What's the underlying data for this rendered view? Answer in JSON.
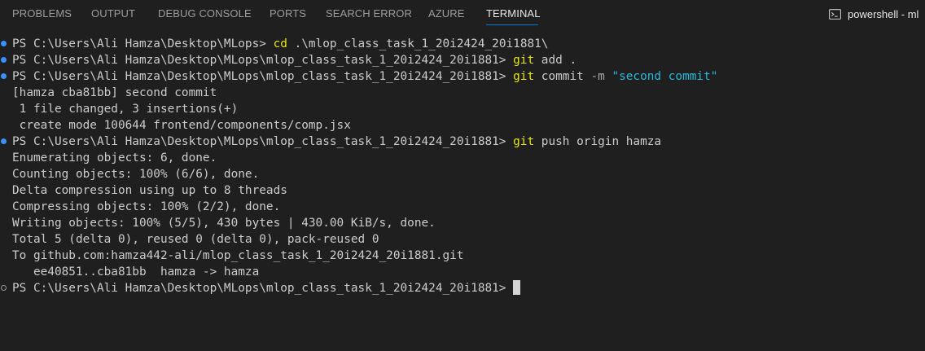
{
  "tabs": [
    {
      "label": "PROBLEMS"
    },
    {
      "label": "OUTPUT"
    },
    {
      "label": "DEBUG CONSOLE"
    },
    {
      "label": "PORTS"
    },
    {
      "label": "SEARCH ERROR"
    },
    {
      "label": "AZURE"
    },
    {
      "label": "TERMINAL"
    }
  ],
  "active_tab": "TERMINAL",
  "terminal_instance": {
    "icon": "terminal-prompt-icon",
    "name": "powershell - ml"
  },
  "colors": {
    "background": "#1f1f1f",
    "tab_text": "#9d9d9d",
    "active_tab": "#e7e7e7",
    "accent": "#0078d4",
    "command_yellow": "#e5e510",
    "string_cyan": "#29b8db",
    "success_decoration": "#3794ff"
  },
  "terminal": {
    "lines": [
      {
        "prompt": "PS C:\\Users\\Ali Hamza\\Desktop\\MLops> ",
        "cmd": "cd",
        "args": " .\\mlop_class_task_1_20i2424_20i1881\\"
      },
      {
        "prompt": "PS C:\\Users\\Ali Hamza\\Desktop\\MLops\\mlop_class_task_1_20i2424_20i1881> ",
        "cmd": "git",
        "args": " add ."
      },
      {
        "prompt": "PS C:\\Users\\Ali Hamza\\Desktop\\MLops\\mlop_class_task_1_20i2424_20i1881> ",
        "cmd": "git",
        "args": " commit ",
        "flag": "-m",
        "str": " \"second commit\""
      },
      {
        "text": "[hamza cba81bb] second commit"
      },
      {
        "text": " 1 file changed, 3 insertions(+)"
      },
      {
        "text": " create mode 100644 frontend/components/comp.jsx"
      },
      {
        "prompt": "PS C:\\Users\\Ali Hamza\\Desktop\\MLops\\mlop_class_task_1_20i2424_20i1881> ",
        "cmd": "git",
        "args": " push origin hamza"
      },
      {
        "text": "Enumerating objects: 6, done."
      },
      {
        "text": "Counting objects: 100% (6/6), done."
      },
      {
        "text": "Delta compression using up to 8 threads"
      },
      {
        "text": "Compressing objects: 100% (2/2), done."
      },
      {
        "text": "Writing objects: 100% (5/5), 430 bytes | 430.00 KiB/s, done."
      },
      {
        "text": "Total 5 (delta 0), reused 0 (delta 0), pack-reused 0"
      },
      {
        "text": "To github.com:hamza442-ali/mlop_class_task_1_20i2424_20i1881.git"
      },
      {
        "text": "   ee40851..cba81bb  hamza -> hamza"
      },
      {
        "prompt": "PS C:\\Users\\Ali Hamza\\Desktop\\MLops\\mlop_class_task_1_20i2424_20i1881> "
      }
    ]
  }
}
